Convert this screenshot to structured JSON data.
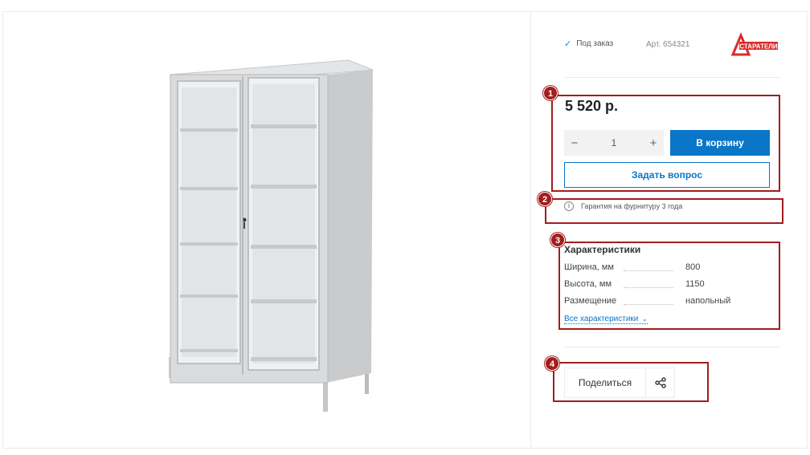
{
  "product": {
    "availability": "Под заказ",
    "article": "Арт. 654321",
    "brand_logo_text": "СТАРАТЕЛИ",
    "price": "5 520 р.",
    "quantity": "1",
    "add_to_cart_label": "В корзину",
    "ask_question_label": "Задать вопрос",
    "warranty_text": "Гарантия на фурнитуру 3 года"
  },
  "specs": {
    "title": "Характеристики",
    "rows": [
      {
        "label": "Ширина, мм",
        "value": "800"
      },
      {
        "label": "Высота, мм",
        "value": "1150"
      },
      {
        "label": "Размещение",
        "value": "напольный"
      }
    ],
    "all_link": "Все характеристики"
  },
  "share": {
    "label": "Поделиться"
  },
  "annotations": [
    "1",
    "2",
    "3",
    "4"
  ],
  "colors": {
    "accent": "#0a76c8",
    "annotation": "#a11d1d",
    "brand": "#d92b2b"
  },
  "icons": {
    "availability": "check-icon",
    "stepper_minus": "minus-icon",
    "stepper_plus": "plus-icon",
    "warranty": "info-icon",
    "all_specs": "chevron-down-icon",
    "share": "share-icon"
  }
}
